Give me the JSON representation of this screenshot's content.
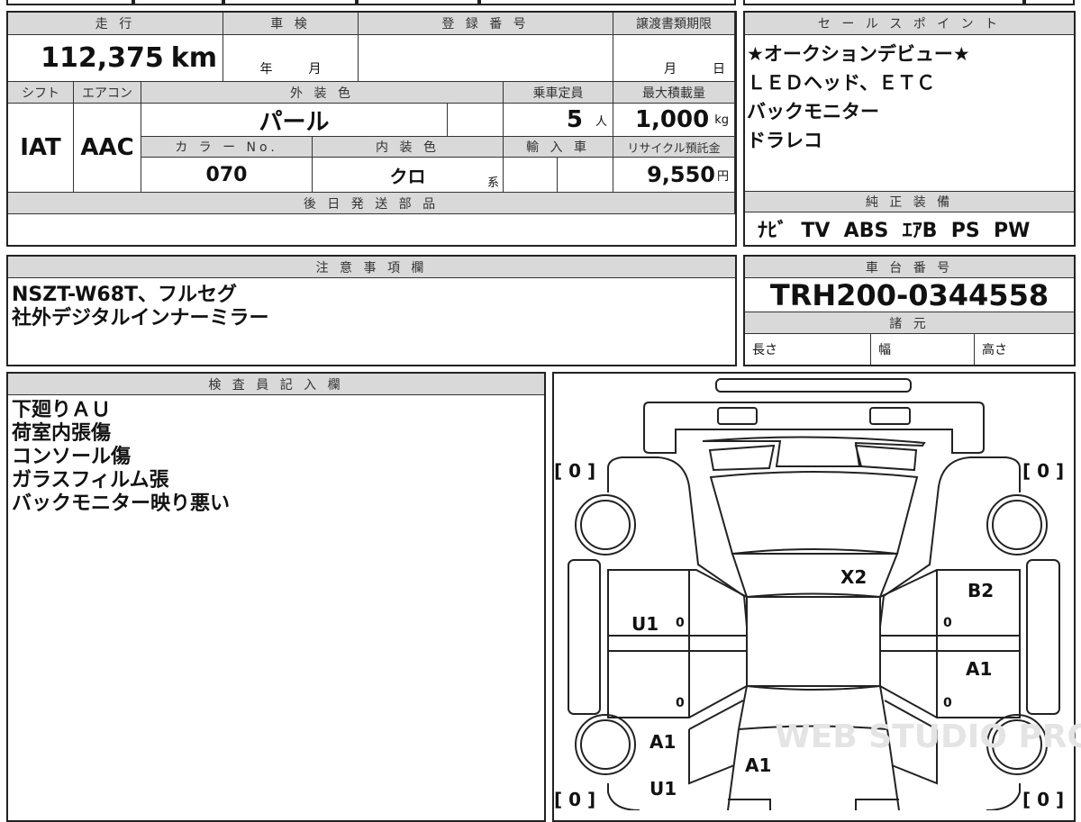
{
  "main_table": {
    "headers": {
      "mileage": "走 行",
      "inspection": "車 検",
      "registration": "登 録 番 号",
      "transfer_deadline": "譲渡書類期限"
    },
    "mileage": {
      "value": "112,375",
      "unit": "km"
    },
    "inspection": {
      "year": "年",
      "month": "月"
    },
    "transfer_deadline": {
      "month": "月",
      "day": "日"
    },
    "headers2": {
      "shift": "シフト",
      "aircon": "エアコン",
      "exterior_color": "外 装 色",
      "capacity": "乗車定員",
      "max_load": "最大積載量"
    },
    "shift": "IAT",
    "aircon": "AAC",
    "exterior_color": "パール",
    "capacity": {
      "value": "5",
      "unit": "人"
    },
    "max_load": {
      "value": "1,000",
      "unit": "kg"
    },
    "headers3": {
      "color_no": "カ ラ ー No.",
      "interior_color": "内 装 色",
      "import": "輸 入 車",
      "recycle_fee": "リサイクル預託金"
    },
    "color_no": "070",
    "interior_color": {
      "value": "クロ",
      "suffix": "系"
    },
    "recycle_fee": {
      "value": "9,550",
      "unit": "円"
    },
    "later_parts_header": "後 日 発 送 部 品"
  },
  "sales_points": {
    "header": "セ ー ル ス ポ イ ン ト",
    "lines": "★オークションデビュー★\nＬＥＤヘッド、ＥＴＣ\nバックモニター\nドラレコ"
  },
  "equipment": {
    "header": "純 正 装 備",
    "value": "ﾅﾋﾞ  TV  ABS  ｴｱB  PS  PW"
  },
  "notes": {
    "header": "注 意 事 項 欄",
    "lines": "NSZT-W68T、フルセグ\n社外デジタルインナーミラー"
  },
  "chassis": {
    "header": "車 台 番 号",
    "value": "TRH200-0344558",
    "spec_header": "諸 元",
    "length": "長さ",
    "width": "幅",
    "height": "高さ"
  },
  "inspector": {
    "header": "検 査 員 記 入 欄",
    "lines": "下廻りＡＵ\n荷室内張傷\nコンソール傷\nガラスフィルム張\nバックモニター映り悪い"
  },
  "diagram": {
    "tires": [
      "[ 0 ]",
      "[ 0 ]",
      "[ 0 ]",
      "[ 0 ]"
    ],
    "marks": {
      "x2": "X2",
      "b2": "B2",
      "u1_left_door": "U1",
      "a1_right_door": "A1",
      "a1_left_rear": "A1",
      "a1_rear": "A1",
      "u1_left_rear": "U1"
    },
    "zeros": [
      "0",
      "0",
      "0",
      "0"
    ],
    "watermark": "WEB STUDIO PRO"
  }
}
